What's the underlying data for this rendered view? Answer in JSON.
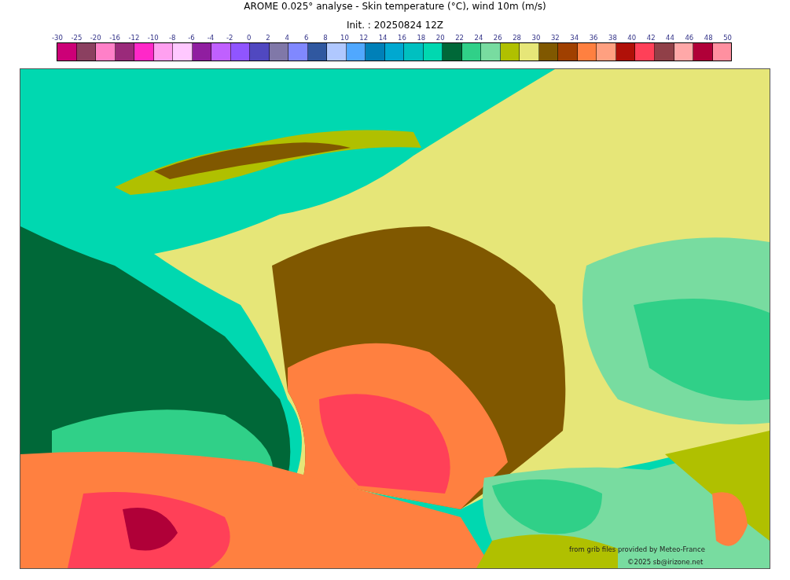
{
  "title": "AROME 0.025° analyse - Skin temperature (°C), wind 10m (m/s)",
  "subtitle": "Init. : 20250824 12Z",
  "colorbar": {
    "ticks": [
      "-30",
      "-25",
      "-20",
      "-16",
      "-12",
      "-10",
      "-8",
      "-6",
      "-4",
      "-2",
      "0",
      "2",
      "4",
      "6",
      "8",
      "10",
      "12",
      "14",
      "16",
      "18",
      "20",
      "22",
      "24",
      "26",
      "28",
      "30",
      "32",
      "34",
      "36",
      "38",
      "40",
      "42",
      "44",
      "46",
      "48",
      "50"
    ],
    "swatches": [
      {
        "color": "#cc0077"
      },
      {
        "color": "#8b4060"
      },
      {
        "color": "#ff80c8"
      },
      {
        "color": "#9a2a7a"
      },
      {
        "color": "#ff28c8"
      },
      {
        "color": "#ffa0f0"
      },
      {
        "color": "#ffc8ff"
      },
      {
        "color": "#901ea0"
      },
      {
        "color": "#c060ff"
      },
      {
        "color": "#9055ff"
      },
      {
        "color": "#5048c0"
      },
      {
        "color": "#8078a8"
      },
      {
        "color": "#8088ff"
      },
      {
        "color": "#3058a0"
      },
      {
        "color": "#b0c8ff"
      },
      {
        "color": "#50a8ff"
      },
      {
        "color": "#0080b8"
      },
      {
        "color": "#00a8d0"
      },
      {
        "color": "#00c0c0"
      },
      {
        "color": "#00d8b0"
      },
      {
        "color": "#006838"
      },
      {
        "color": "#30d088"
      },
      {
        "color": "#78dca0"
      },
      {
        "color": "#b0c000"
      },
      {
        "color": "#e6e678"
      },
      {
        "color": "#805800"
      },
      {
        "color": "#a04000"
      },
      {
        "color": "#ff8040"
      },
      {
        "color": "#ffa080"
      },
      {
        "color": "#b01008"
      },
      {
        "color": "#ff4058"
      },
      {
        "color": "#904048"
      },
      {
        "color": "#ffa8a8"
      },
      {
        "color": "#b00038"
      },
      {
        "color": "#ff90a0"
      }
    ]
  },
  "credits": [
    "from grib files provided by Meteo-France",
    "©2025 sb@irizone.net"
  ]
}
